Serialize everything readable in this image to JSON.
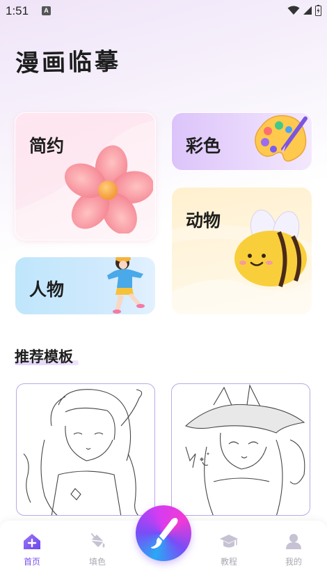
{
  "status_bar": {
    "time": "1:51",
    "notification_badge": "A"
  },
  "app_title": "漫画临摹",
  "categories": [
    {
      "label": "简约",
      "icon": "flower-icon"
    },
    {
      "label": "彩色",
      "icon": "palette-icon"
    },
    {
      "label": "动物",
      "icon": "bee-icon"
    },
    {
      "label": "人物",
      "icon": "girl-figure-icon"
    }
  ],
  "section": {
    "title": "推荐模板"
  },
  "templates": [
    {
      "name": "girl-lineart-template"
    },
    {
      "name": "foxgirl-lineart-template"
    }
  ],
  "tab_bar": {
    "items": [
      {
        "label": "首页",
        "icon": "home-icon",
        "active": true
      },
      {
        "label": "填色",
        "icon": "paint-bucket-icon",
        "active": false
      },
      {
        "label": "教程",
        "icon": "graduation-cap-icon",
        "active": false
      },
      {
        "label": "我的",
        "icon": "user-icon",
        "active": false
      }
    ],
    "fab_icon": "brush-icon"
  },
  "colors": {
    "accent": "#7b4ff0",
    "inactive": "#a9a9b3"
  }
}
